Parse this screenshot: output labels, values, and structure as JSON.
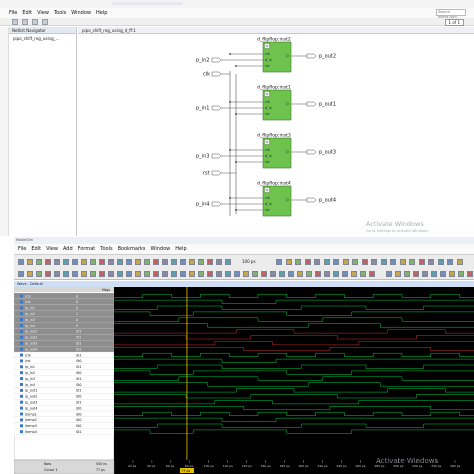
{
  "top_window": {
    "menu": [
      "File",
      "Edit",
      "View",
      "Tools",
      "Window",
      "Help"
    ],
    "search_placeholder": "Search altera.com",
    "page_indicator": "1 of 1",
    "nav_title": "Netlist Navigator",
    "nav_item": "pipo_shift_reg_using_...",
    "doc_tab": "pipo_shift_reg_using_d_ff:1",
    "watermark_title": "Activate Windows",
    "watermark_sub": "Go to Settings to activate Windows.",
    "schematic": {
      "flipflops": [
        {
          "label": "d_flipflop:inst2",
          "in_port": "p_in2",
          "out_port": "p_out2"
        },
        {
          "label": "d_flipflop:inst1",
          "in_port": "p_in1",
          "out_port": "p_out1"
        },
        {
          "label": "d_flipflop:inst3",
          "in_port": "p_in3",
          "out_port": "p_out3"
        },
        {
          "label": "d_flipflop:inst4",
          "in_port": "p_in4",
          "out_port": "p_out4"
        }
      ],
      "shared_ports": {
        "clk": "clk",
        "rst": "rst"
      },
      "pin_labels": {
        "clk": "clk",
        "d_in": "d_in",
        "rst": "rst",
        "q": "Q"
      }
    }
  },
  "bottom_window": {
    "title": "ModelSim",
    "menu": [
      "File",
      "Edit",
      "View",
      "Add",
      "Format",
      "Tools",
      "Bookmarks",
      "Window",
      "Help"
    ],
    "time_field": "100 ps",
    "wave_title": "Wave - Default",
    "msgs_header": "Msgs",
    "signals_top": [
      {
        "name": "clk",
        "value": "0"
      },
      {
        "name": "rst",
        "value": "0"
      },
      {
        "name": "p_in1",
        "value": "0"
      },
      {
        "name": "p_in2",
        "value": "1"
      },
      {
        "name": "p_in3",
        "value": "0"
      },
      {
        "name": "p_in4",
        "value": "0"
      },
      {
        "name": "p_out1",
        "value": "St1"
      },
      {
        "name": "p_out2",
        "value": "St1"
      },
      {
        "name": "p_out3",
        "value": "St1"
      },
      {
        "name": "p_out4",
        "value": "St1"
      }
    ],
    "signals_bottom": [
      {
        "name": "clk",
        "value": "St1"
      },
      {
        "name": "rst",
        "value": "St0"
      },
      {
        "name": "p_in1",
        "value": "St1"
      },
      {
        "name": "p_in2",
        "value": "St0"
      },
      {
        "name": "p_in3",
        "value": "St1"
      },
      {
        "name": "p_in4",
        "value": "St0"
      },
      {
        "name": "p_out1",
        "value": "St1"
      },
      {
        "name": "p_out2",
        "value": "St0"
      },
      {
        "name": "p_out3",
        "value": "St1"
      },
      {
        "name": "p_out4",
        "value": "St0"
      },
      {
        "name": "temp1",
        "value": "St0"
      },
      {
        "name": "temp2",
        "value": "St0"
      },
      {
        "name": "temp3",
        "value": "St0"
      },
      {
        "name": "temp4",
        "value": "St1"
      }
    ],
    "footer": {
      "now_label": "Now",
      "now_value": "500 ns",
      "cursor_label": "Cursor 1",
      "cursor_value": "77 ps"
    },
    "time_ticks": [
      "20 ps",
      "40 ps",
      "60 ps",
      "80 ps",
      "100 ps",
      "120 ps",
      "140 ps",
      "160 ps",
      "180 ps",
      "200 ps",
      "220 ps",
      "240 ps",
      "260 ps",
      "280 ps",
      "300 ps",
      "320 ps",
      "340 ps",
      "360 ps"
    ],
    "cursor_marker": "77 ps",
    "colors": {
      "wave": "#00cc44",
      "wave_bg": "#000000",
      "cursor": "#e6c200",
      "selected_rows": "#8e8e8e",
      "ff_block": "#6ec24e"
    }
  }
}
